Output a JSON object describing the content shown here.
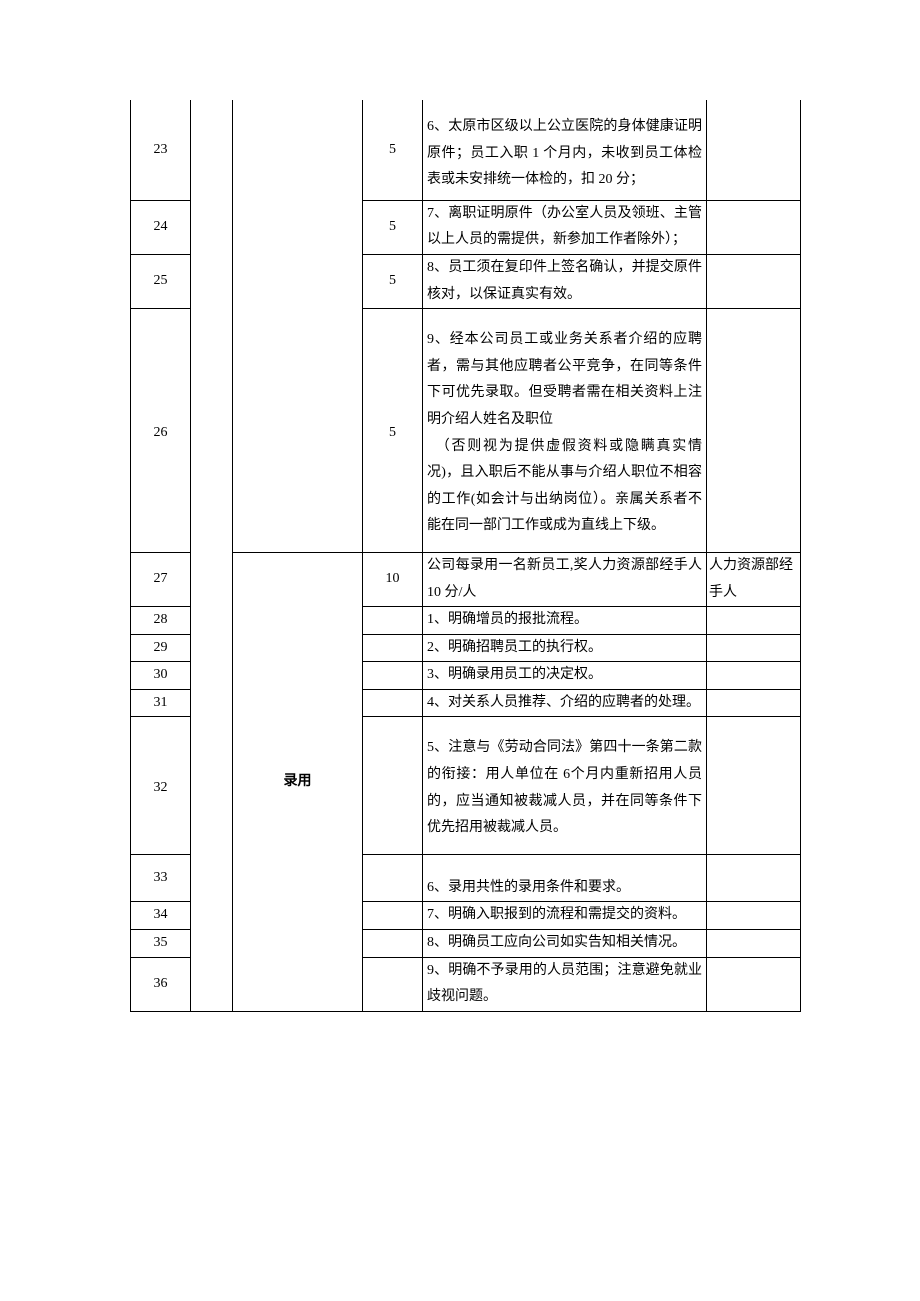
{
  "rows": [
    {
      "num": "23",
      "score": "5",
      "desc": "6、太原市区级以上公立医院的身体健康证明原件；员工入职 1 个月内，未收到员工体检表或未安排统一体检的，扣 20 分；",
      "resp": ""
    },
    {
      "num": "24",
      "score": "5",
      "desc": "7、离职证明原件（办公室人员及领班、主管以上人员的需提供，新参加工作者除外）；",
      "resp": ""
    },
    {
      "num": "25",
      "score": "5",
      "desc": "8、员工须在复印件上签名确认，并提交原件核对，以保证真实有效。",
      "resp": ""
    },
    {
      "num": "26",
      "score": "5",
      "desc": "9、经本公司员工或业务关系者介绍的应聘者，需与其他应聘者公平竞争，在同等条件下可优先录取。但受聘者需在相关资料上注明介绍人姓名及职位\n　（否则视为提供虚假资料或隐瞒真实情况)，且入职后不能从事与介绍人职位不相容的工作(如会计与出纳岗位）。亲属关系者不能在同一部门工作或成为直线上下级。",
      "resp": ""
    },
    {
      "num": "27",
      "score": "10",
      "desc": "公司每录用一名新员工,奖人力资源部经手人 10 分/人",
      "resp": "人力资源部经手人"
    },
    {
      "num": "28",
      "score": "",
      "desc": "1、明确增员的报批流程。",
      "resp": ""
    },
    {
      "num": "29",
      "score": "",
      "desc": "2、明确招聘员工的执行权。",
      "resp": ""
    },
    {
      "num": "30",
      "score": "",
      "desc": "3、明确录用员工的决定权。",
      "resp": ""
    },
    {
      "num": "31",
      "score": "",
      "desc": "4、对关系人员推荐、介绍的应聘者的处理。",
      "resp": ""
    },
    {
      "num": "32",
      "score": "",
      "desc": "5、注意与《劳动合同法》第四十一条第二款的衔接：用人单位在 6个月内重新招用人员的，应当通知被裁减人员，并在同等条件下优先招用被裁减人员。",
      "resp": ""
    },
    {
      "num": "33",
      "score": "",
      "desc": "6、录用共性的录用条件和要求。",
      "resp": ""
    },
    {
      "num": "34",
      "score": "",
      "desc": "7、明确入职报到的流程和需提交的资料。",
      "resp": ""
    },
    {
      "num": "35",
      "score": "",
      "desc": "8、明确员工应向公司如实告知相关情况。",
      "resp": ""
    },
    {
      "num": "36",
      "score": "",
      "desc": "9、明确不予录用的人员范围；注意避免就业歧视问题。",
      "resp": ""
    }
  ],
  "section_label": "录用"
}
